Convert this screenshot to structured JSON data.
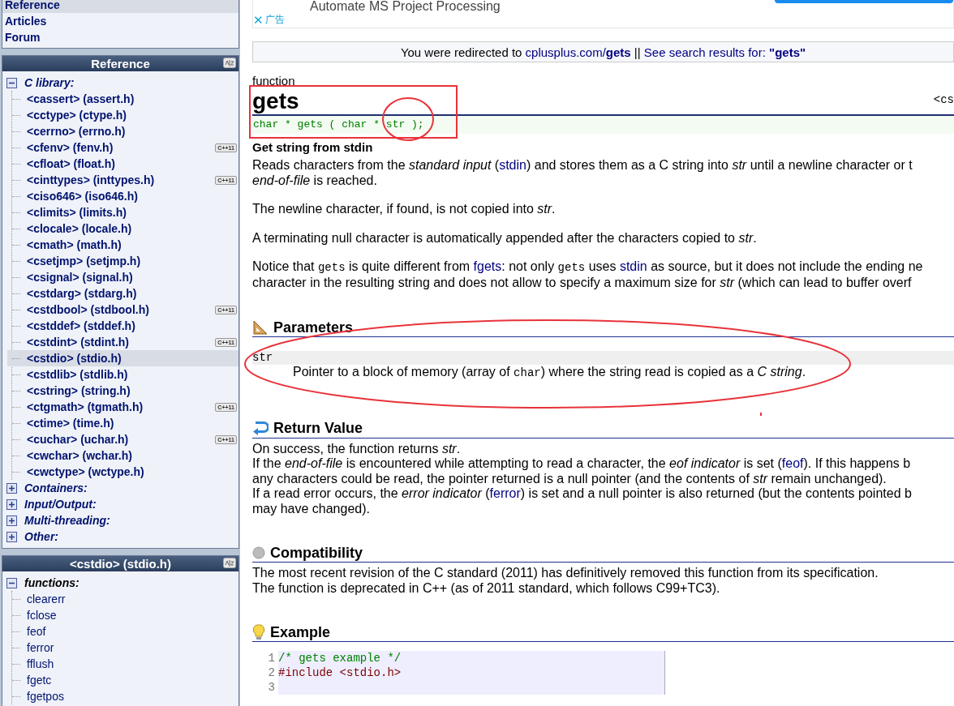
{
  "sidebar": {
    "nav": [
      {
        "label": "Reference",
        "selected": true
      },
      {
        "label": "Articles",
        "selected": false
      },
      {
        "label": "Forum",
        "selected": false
      }
    ],
    "reference": {
      "title": "Reference",
      "groups": [
        {
          "label": "C library:",
          "expanded": true,
          "items": [
            {
              "label": "<cassert> (assert.h)",
              "selected": false
            },
            {
              "label": "<cctype> (ctype.h)",
              "selected": false
            },
            {
              "label": "<cerrno> (errno.h)",
              "selected": false
            },
            {
              "label": "<cfenv> (fenv.h)",
              "selected": false,
              "badge": "C++11"
            },
            {
              "label": "<cfloat> (float.h)",
              "selected": false
            },
            {
              "label": "<cinttypes> (inttypes.h)",
              "selected": false,
              "badge": "C++11"
            },
            {
              "label": "<ciso646> (iso646.h)",
              "selected": false
            },
            {
              "label": "<climits> (limits.h)",
              "selected": false
            },
            {
              "label": "<clocale> (locale.h)",
              "selected": false
            },
            {
              "label": "<cmath> (math.h)",
              "selected": false
            },
            {
              "label": "<csetjmp> (setjmp.h)",
              "selected": false
            },
            {
              "label": "<csignal> (signal.h)",
              "selected": false
            },
            {
              "label": "<cstdarg> (stdarg.h)",
              "selected": false
            },
            {
              "label": "<cstdbool> (stdbool.h)",
              "selected": false,
              "badge": "C++11"
            },
            {
              "label": "<cstddef> (stddef.h)",
              "selected": false
            },
            {
              "label": "<cstdint> (stdint.h)",
              "selected": false,
              "badge": "C++11"
            },
            {
              "label": "<cstdio> (stdio.h)",
              "selected": true
            },
            {
              "label": "<cstdlib> (stdlib.h)",
              "selected": false
            },
            {
              "label": "<cstring> (string.h)",
              "selected": false
            },
            {
              "label": "<ctgmath> (tgmath.h)",
              "selected": false,
              "badge": "C++11"
            },
            {
              "label": "<ctime> (time.h)",
              "selected": false
            },
            {
              "label": "<cuchar> (uchar.h)",
              "selected": false,
              "badge": "C++11"
            },
            {
              "label": "<cwchar> (wchar.h)",
              "selected": false
            },
            {
              "label": "<cwctype> (wctype.h)",
              "selected": false
            }
          ]
        },
        {
          "label": "Containers:",
          "expanded": false
        },
        {
          "label": "Input/Output:",
          "expanded": false
        },
        {
          "label": "Multi-threading:",
          "expanded": false
        },
        {
          "label": "Other:",
          "expanded": false
        }
      ]
    },
    "header_panel": {
      "title": "<cstdio> (stdio.h)",
      "groups": [
        {
          "label": "functions:",
          "expanded": true,
          "items": [
            {
              "label": "clearerr",
              "selected": false
            },
            {
              "label": "fclose",
              "selected": false
            },
            {
              "label": "feof",
              "selected": false
            },
            {
              "label": "ferror",
              "selected": false
            },
            {
              "label": "fflush",
              "selected": false
            },
            {
              "label": "fgetc",
              "selected": false
            },
            {
              "label": "fgetpos",
              "selected": false
            }
          ]
        }
      ]
    }
  },
  "ad": {
    "title": "Automate MS Project Processing",
    "label": "广告",
    "close": "✕"
  },
  "redirect": [
    {
      "text": "You were redirected to ",
      "kind": "plain"
    },
    {
      "text": "cplusplus.com/",
      "kind": "link"
    },
    {
      "text": "gets",
      "kind": "linkbold"
    },
    {
      "text": " || ",
      "kind": "plain"
    },
    {
      "text": "See search results for: ",
      "kind": "link"
    },
    {
      "text": "\"gets\"",
      "kind": "linkbold"
    }
  ],
  "entry": {
    "type": "function",
    "name": "gets",
    "header": "<cs",
    "prototype": "char * gets ( char * str );",
    "summary": "Get string from stdin"
  },
  "description": [
    [
      [
        {
          "text": "Reads characters from the ",
          "kind": "plain"
        },
        {
          "text": "standard input",
          "kind": "em"
        },
        {
          "text": " (",
          "kind": "plain"
        },
        {
          "text": "stdin",
          "kind": "link"
        },
        {
          "text": ") and stores them as a C string into ",
          "kind": "plain"
        },
        {
          "text": "str",
          "kind": "em"
        },
        {
          "text": " until a newline character or t",
          "kind": "plain"
        }
      ],
      [
        {
          "text": "end-of-file",
          "kind": "em"
        },
        {
          "text": " is reached.",
          "kind": "plain"
        }
      ]
    ],
    [
      [
        {
          "text": "The newline character, if found, is not copied into ",
          "kind": "plain"
        },
        {
          "text": "str",
          "kind": "em"
        },
        {
          "text": ".",
          "kind": "plain"
        }
      ]
    ],
    [
      [
        {
          "text": "A terminating null character is automatically appended after the characters copied to ",
          "kind": "plain"
        },
        {
          "text": "str",
          "kind": "em"
        },
        {
          "text": ".",
          "kind": "plain"
        }
      ]
    ],
    [
      [
        {
          "text": "Notice that ",
          "kind": "plain"
        },
        {
          "text": "gets",
          "kind": "code"
        },
        {
          "text": " is quite different from ",
          "kind": "plain"
        },
        {
          "text": "fgets",
          "kind": "link"
        },
        {
          "text": ": not only ",
          "kind": "plain"
        },
        {
          "text": "gets",
          "kind": "code"
        },
        {
          "text": " uses ",
          "kind": "plain"
        },
        {
          "text": "stdin",
          "kind": "link"
        },
        {
          "text": " as source, but it does not include the ending ne",
          "kind": "plain"
        }
      ],
      [
        {
          "text": "character in the resulting string and does not allow to specify a maximum size for ",
          "kind": "plain"
        },
        {
          "text": "str",
          "kind": "em"
        },
        {
          "text": " (which can lead to buffer overf",
          "kind": "plain"
        }
      ]
    ]
  ],
  "sections": [
    {
      "kind": "parameters",
      "title": "Parameters",
      "params": [
        {
          "name": "str",
          "desc": [
            {
              "text": "Pointer to a block of memory (array of ",
              "kind": "plain"
            },
            {
              "text": "char",
              "kind": "code"
            },
            {
              "text": ") where the string read is copied as a ",
              "kind": "plain"
            },
            {
              "text": "C string",
              "kind": "em"
            },
            {
              "text": ".",
              "kind": "plain"
            }
          ]
        }
      ]
    },
    {
      "kind": "return",
      "title": "Return Value",
      "lines": [
        [
          {
            "text": "On success, the function returns ",
            "kind": "plain"
          },
          {
            "text": "str",
            "kind": "em"
          },
          {
            "text": ".",
            "kind": "plain"
          }
        ],
        [
          {
            "text": "If the ",
            "kind": "plain"
          },
          {
            "text": "end-of-file",
            "kind": "em"
          },
          {
            "text": " is encountered while attempting to read a character, the ",
            "kind": "plain"
          },
          {
            "text": "eof indicator",
            "kind": "em"
          },
          {
            "text": " is set (",
            "kind": "plain"
          },
          {
            "text": "feof",
            "kind": "link"
          },
          {
            "text": "). If this happens b",
            "kind": "plain"
          }
        ],
        [
          {
            "text": "any characters could be read, the pointer returned is a null pointer (and the contents of ",
            "kind": "plain"
          },
          {
            "text": "str",
            "kind": "em"
          },
          {
            "text": " remain unchanged).",
            "kind": "plain"
          }
        ],
        [
          {
            "text": "If a read error occurs, the ",
            "kind": "plain"
          },
          {
            "text": "error indicator",
            "kind": "em"
          },
          {
            "text": " (",
            "kind": "plain"
          },
          {
            "text": "ferror",
            "kind": "link"
          },
          {
            "text": ") is set and a null pointer is also returned (but the contents pointed b",
            "kind": "plain"
          }
        ],
        [
          {
            "text": "may have changed).",
            "kind": "plain"
          }
        ]
      ]
    },
    {
      "kind": "compatibility",
      "title": "Compatibility",
      "lines": [
        [
          {
            "text": "The most recent revision of the C standard (2011) has definitively removed this function from its specification.",
            "kind": "plain"
          }
        ],
        [
          {
            "text": "The function is deprecated in C++ (as of 2011 standard, which follows C99+TC3).",
            "kind": "plain"
          }
        ]
      ]
    },
    {
      "kind": "example",
      "title": "Example",
      "code": [
        {
          "num": "1",
          "code": "/* gets example */",
          "kind": "comment"
        },
        {
          "num": "2",
          "code": "#include <stdio.h>",
          "kind": "directive"
        },
        {
          "num": "3"
        }
      ]
    }
  ]
}
